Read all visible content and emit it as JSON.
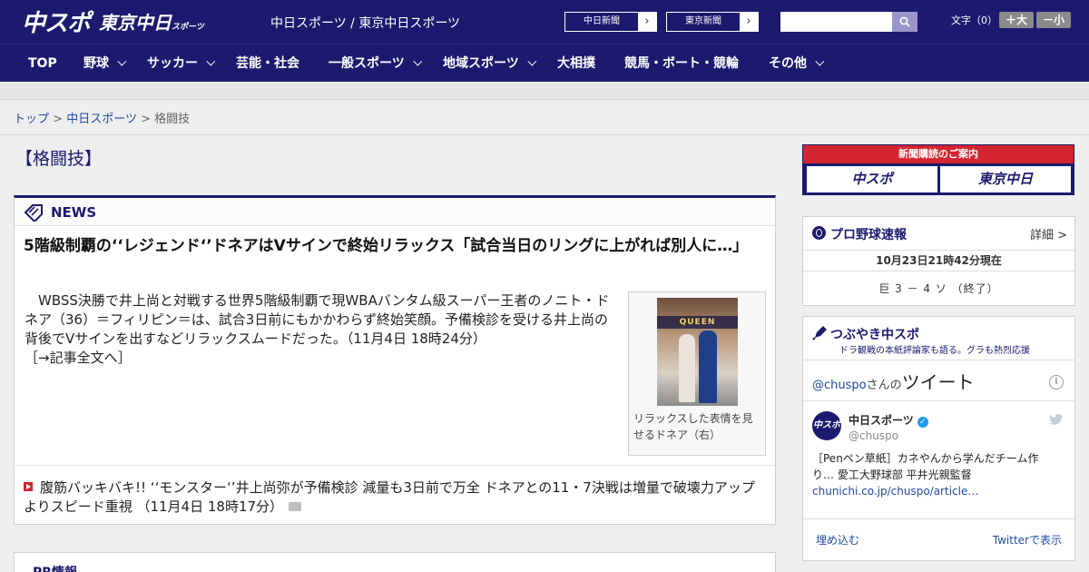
{
  "header": {
    "logo_main": "中スポ",
    "logo_sub": "東京中日",
    "logo_sub_small": "スポーツ",
    "site_title": "中日スポーツ / 東京中日スポーツ",
    "paper_links": [
      {
        "label": "中日新聞"
      },
      {
        "label": "東京新聞"
      }
    ],
    "search_placeholder": "",
    "font_size_label": "文字（0）",
    "font_larger": "＋大",
    "font_smaller": "－小"
  },
  "nav": [
    {
      "label": "TOP",
      "dropdown": false
    },
    {
      "label": "野球",
      "dropdown": true
    },
    {
      "label": "サッカー",
      "dropdown": true
    },
    {
      "label": "芸能・社会",
      "dropdown": false
    },
    {
      "label": "一般スポーツ",
      "dropdown": true
    },
    {
      "label": "地域スポーツ",
      "dropdown": true
    },
    {
      "label": "大相撲",
      "dropdown": false
    },
    {
      "label": "競馬・ボート・競輪",
      "dropdown": false
    },
    {
      "label": "その他",
      "dropdown": true
    }
  ],
  "breadcrumb": {
    "items": [
      "トップ",
      "中日スポーツ",
      "格闘技"
    ],
    "sep": ">"
  },
  "category_title": "【格闘技】",
  "news": {
    "section_label": "NEWS",
    "headline": "5階級制覇の‘‘レジェンド‘’ドネアはVサインで終始リラックス「試合当日のリングに上がれば別人に…」",
    "summary": "WBSS決勝で井上尚と対戦する世界5階級制覇で現WBAバンタム級スーパー王者のノニト・ドネア（36）＝フィリピン＝は、試合3日前にもかかわらず終始笑顔。予備検診を受ける井上尚の背後でVサインを出すなどリラックスムードだった。（11月4日 18時24分）",
    "more": "［→記事全文へ］",
    "photo_banner": "QUEEN",
    "photo_caption": "リラックスした表情を見せるドネア（右）",
    "sub_headline": "腹筋バッキバキ!! ‘‘モンスター‘’井上尚弥が予備検診 減量も3日前で万全 ドネアとの11・7決戦は増量で破壊力アップよりスピード重視 （11月4日 18時17分）"
  },
  "pr": {
    "label": "PR情報"
  },
  "sidebar": {
    "subscribe": {
      "top": "新聞購読のご案内",
      "logo_a": "中スポ",
      "logo_b": "東京中日"
    },
    "baseball": {
      "title": "プロ野球速報",
      "detail": "詳細 >",
      "updated": "10月23日21時42分現在",
      "score": "巨 3 － 4 ソ （終了）"
    },
    "twitter": {
      "title": "つぶやき中スポ",
      "subtitle": "ドラ観戦の本紙評論家も語る。グラも熱烈応援",
      "handle": "@chuspo",
      "handle_suffix": "さんの",
      "tweet_word": "ツイート",
      "account_name": "中日スポーツ",
      "account_handle": "@chuspo",
      "avatar_text": "中スポ",
      "tweet_text": "［Penペン草紙］カネやんから学んだチーム作り… 愛工大野球部 平井光親監督",
      "tweet_link": "chunichi.co.jp/chuspo/article…",
      "embed": "埋め込む",
      "view": "Twitterで表示"
    }
  },
  "colors": {
    "brand_navy": "#1c1a6e",
    "accent_red": "#d2252f",
    "link_blue": "#1f4aa6"
  }
}
